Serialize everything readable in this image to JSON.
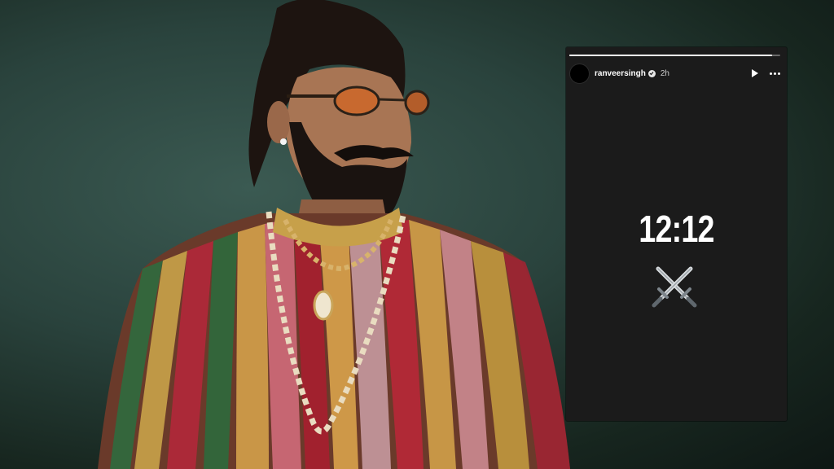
{
  "story": {
    "username": "ranveersingh",
    "time": "2h",
    "text": "12:12",
    "progress": 0.96,
    "sticker_icon": "crossed-swords-icon"
  },
  "icons": [
    "verified-badge-icon",
    "play-icon",
    "more-options-icon",
    "crossed-swords-icon"
  ]
}
